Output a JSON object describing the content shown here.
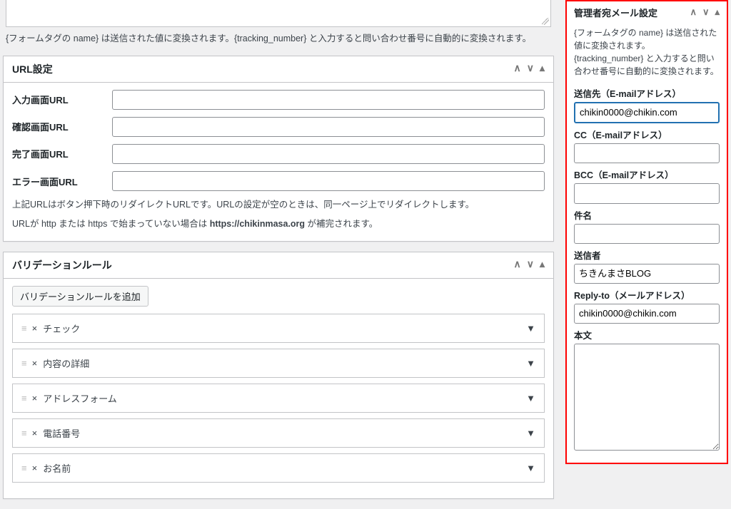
{
  "leftTopHelp": "{フォームタグの name} は送信された値に変換されます。{tracking_number} と入力すると問い合わせ番号に自動的に変換されます。",
  "urlPanel": {
    "title": "URL設定",
    "rows": [
      {
        "label": "入力画面URL",
        "value": ""
      },
      {
        "label": "確認画面URL",
        "value": ""
      },
      {
        "label": "完了画面URL",
        "value": ""
      },
      {
        "label": "エラー画面URL",
        "value": ""
      }
    ],
    "help1": "上記URLはボタン押下時のリダイレクトURLです。URLの設定が空のときは、同一ページ上でリダイレクトします。",
    "help2_prefix": "URLが http または https で始まっていない場合は ",
    "help2_bold": "https://chikinmasa.org",
    "help2_suffix": " が補完されます。"
  },
  "validationPanel": {
    "title": "バリデーションルール",
    "addBtn": "バリデーションルールを追加",
    "rules": [
      {
        "name": "チェック"
      },
      {
        "name": "内容の詳細"
      },
      {
        "name": "アドレスフォーム"
      },
      {
        "name": "電話番号"
      },
      {
        "name": "お名前"
      }
    ]
  },
  "sidebar": {
    "title": "管理者宛メール設定",
    "help": "{フォームタグの name} は送信された値に変換されます。{tracking_number} と入力すると問い合わせ番号に自動的に変換されます。",
    "fields": {
      "to_label": "送信先（E-mailアドレス）",
      "to_value": "chikin0000@chikin.com",
      "cc_label": "CC（E-mailアドレス）",
      "cc_value": "",
      "bcc_label": "BCC（E-mailアドレス）",
      "bcc_value": "",
      "subject_label": "件名",
      "subject_value": "",
      "sender_label": "送信者",
      "sender_value": "ちきんまさBLOG",
      "reply_label": "Reply-to（メールアドレス）",
      "reply_value": "chikin0000@chikin.com",
      "body_label": "本文",
      "body_value": ""
    }
  }
}
